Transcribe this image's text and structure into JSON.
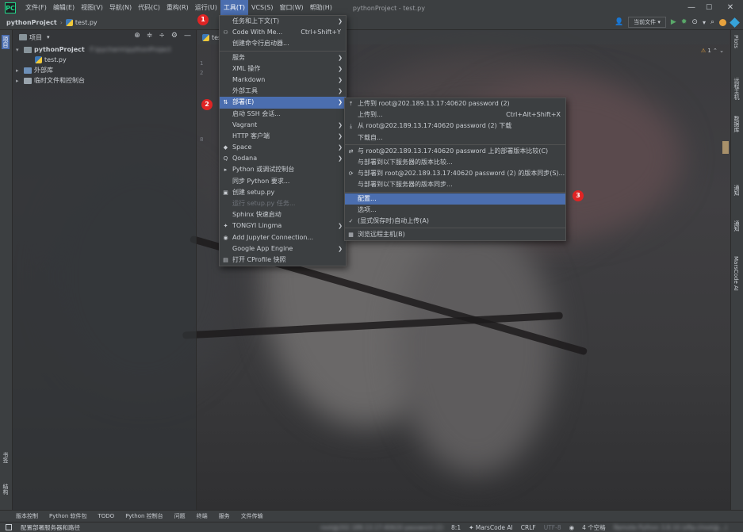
{
  "app": {
    "logo": "PC",
    "window_title": "pythonProject - test.py"
  },
  "menubar": [
    "文件(F)",
    "编辑(E)",
    "视图(V)",
    "导航(N)",
    "代码(C)",
    "重构(R)",
    "运行(U)",
    "工具(T)",
    "VCS(S)",
    "窗口(W)",
    "帮助(H)"
  ],
  "active_menu": "工具(T)",
  "window_controls": {
    "minimize": "—",
    "maximize": "☐",
    "close": "✕"
  },
  "navbar": {
    "project": "pythonProject",
    "file": "test.py",
    "run_config": "当前文件",
    "run_config_arrow": "▾"
  },
  "left_tabs": {
    "project": "项目",
    "bookmarks": "书签",
    "structure": "结构"
  },
  "right_tabs": {
    "plots": "Plots",
    "remote": "远程主机",
    "database": "数据库",
    "notifications": "通知",
    "sciview": "通知",
    "marscode": "MarsCode AI"
  },
  "project_panel": {
    "title": "项目",
    "tree": [
      {
        "label": "pythonProject",
        "suffix": "F:\\pycharm\\pythonProject",
        "level": 0,
        "expanded": true,
        "bold": true
      },
      {
        "label": "test.py",
        "level": 1,
        "type": "file"
      },
      {
        "label": "外部库",
        "level": 0,
        "expanded": false
      },
      {
        "label": "临时文件和控制台",
        "level": 0,
        "expanded": false
      }
    ]
  },
  "editor": {
    "tab": "test.py",
    "gutter": [
      "1",
      "2",
      "",
      "",
      "",
      "",
      "",
      "",
      "8"
    ],
    "warning_count": "1"
  },
  "tools_menu": [
    {
      "label": "任务和上下文(T)",
      "submenu": true
    },
    {
      "label": "Code With Me...",
      "shortcut": "Ctrl+Shift+Y",
      "icon": "⚇"
    },
    {
      "label": "创建命令行启动器..."
    },
    {
      "sep": true
    },
    {
      "label": "服务",
      "submenu": true
    },
    {
      "label": "XML 操作",
      "submenu": true
    },
    {
      "label": "Markdown",
      "submenu": true
    },
    {
      "label": "外部工具",
      "submenu": true
    },
    {
      "label": "部署(E)",
      "submenu": true,
      "selected": true,
      "icon": "⇅"
    },
    {
      "label": "启动 SSH 会话..."
    },
    {
      "label": "Vagrant",
      "submenu": true
    },
    {
      "label": "HTTP 客户端",
      "submenu": true
    },
    {
      "label": "Space",
      "submenu": true,
      "icon": "◆"
    },
    {
      "label": "Qodana",
      "submenu": true,
      "icon": "Q"
    },
    {
      "label": "Python 或调试控制台",
      "icon": "▸"
    },
    {
      "label": "同步 Python 要求..."
    },
    {
      "label": "创建 setup.py",
      "icon": "▣"
    },
    {
      "label": "运行 setup.py 任务...",
      "disabled": true
    },
    {
      "label": "Sphinx 快速启动"
    },
    {
      "label": "TONGYI Lingma",
      "submenu": true,
      "icon": "✦"
    },
    {
      "label": "Add Jupyter Connection...",
      "icon": "◉"
    },
    {
      "label": "Google App Engine",
      "submenu": true
    },
    {
      "label": "打开 CProfile 快照",
      "icon": "▤"
    }
  ],
  "deploy_menu": [
    {
      "label": "上传到 root@202.189.13.17:40620 password (2)",
      "icon": "⤒",
      "blurred_part": true
    },
    {
      "label": "上传到...",
      "shortcut": "Ctrl+Alt+Shift+X"
    },
    {
      "label": "从 root@202.189.13.17:40620 password (2) 下载",
      "icon": "⤓",
      "blurred_part": true
    },
    {
      "label": "下载自..."
    },
    {
      "sep": true
    },
    {
      "label": "与 root@202.189.13.17:40620 password 上的部署版本比较(C)",
      "icon": "⇄"
    },
    {
      "label": "与部署到以下服务器的版本比较..."
    },
    {
      "label": "与部署到 root@202.189.13.17:40620 password (2) 的版本同步(S)...",
      "icon": "⟳"
    },
    {
      "label": "与部署到以下服务器的版本同步..."
    },
    {
      "sep": true
    },
    {
      "label": "配置...",
      "selected": true
    },
    {
      "label": "选项..."
    },
    {
      "label": "(显式保存时)自动上传(A)",
      "icon": "✓"
    },
    {
      "sep": true
    },
    {
      "label": "浏览远程主机(B)",
      "icon": "▦"
    }
  ],
  "badges": [
    "1",
    "2",
    "3"
  ],
  "bottom_tools": [
    "版本控制",
    "Python 软件包",
    "TODO",
    "Python 控制台",
    "问题",
    "终端",
    "服务",
    "文件传输"
  ],
  "status": {
    "message": "配置部署服务器和路径",
    "remote": "root@202.189.13.17:40620 password (2)",
    "position": "8:1",
    "marscode": "MarsCode AI",
    "line_ending": "CRLF",
    "encoding": "UTF-8",
    "indent": "4 个空格",
    "interpreter": "Remote Python 3.8.10 (sftp://root@...)"
  },
  "colors": {
    "accent": "#4b6eaf",
    "badge": "#e02424",
    "menu_bg": "#3c3f41"
  }
}
